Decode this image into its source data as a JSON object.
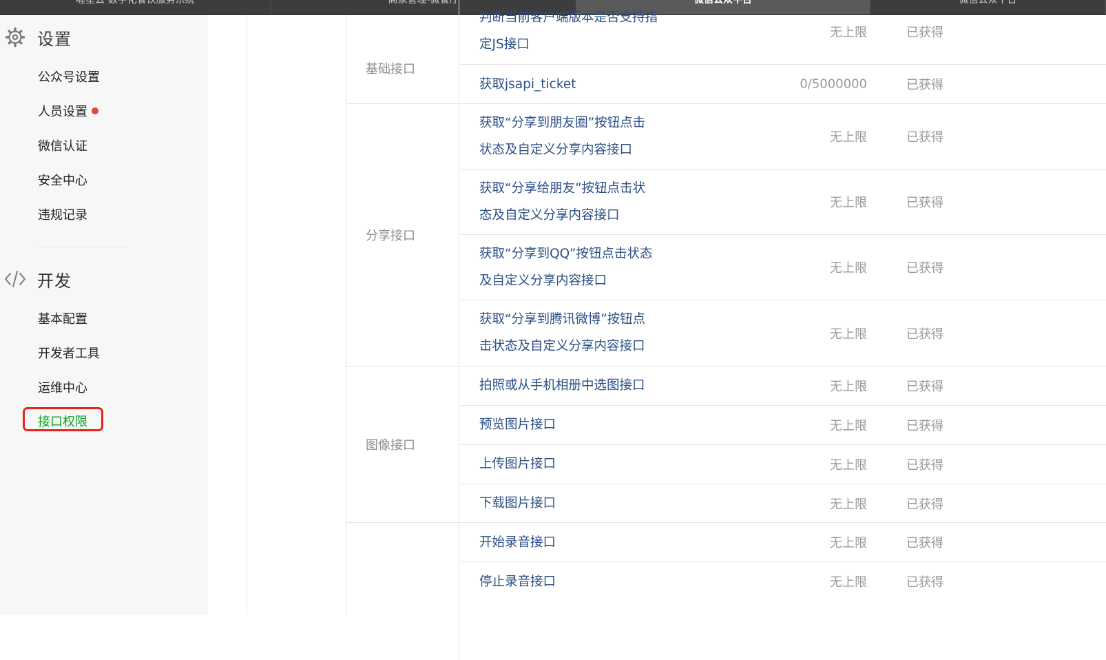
{
  "top_tabs": [
    {
      "label": "喔星云·数字化餐饮服务系统"
    },
    {
      "label": "商家管理-微餐厅"
    },
    {
      "label": "微信公众平台"
    },
    {
      "label": "微信公众平台"
    }
  ],
  "sidebar": {
    "settings": {
      "title": "设置",
      "icon": "gear-icon",
      "items": [
        {
          "label": "公众号设置"
        },
        {
          "label": "人员设置"
        },
        {
          "label": "微信认证"
        },
        {
          "label": "安全中心"
        },
        {
          "label": "违规记录"
        }
      ]
    },
    "develop": {
      "title": "开发",
      "icon": "code-icon",
      "items": [
        {
          "label": "基本配置"
        },
        {
          "label": "开发者工具"
        },
        {
          "label": "运维中心"
        },
        {
          "label": "接口权限"
        }
      ]
    }
  },
  "table": {
    "categories": [
      {
        "label": "基础接口"
      },
      {
        "label": "分享接口"
      },
      {
        "label": "图像接口"
      },
      {
        "label": ""
      }
    ],
    "rows": [
      {
        "name_line1": "判断当前客户端版本是否支持指",
        "name_line2": "定JS接口",
        "quota": "无上限",
        "status": "已获得"
      },
      {
        "name_line1": "获取jsapi_ticket",
        "quota": "0/5000000",
        "status": "已获得"
      },
      {
        "name_line1": "获取“分享到朋友圈”按钮点击",
        "name_line2": "状态及自定义分享内容接口",
        "quota": "无上限",
        "status": "已获得"
      },
      {
        "name_line1": "获取“分享给朋友”按钮点击状",
        "name_line2": "态及自定义分享内容接口",
        "quota": "无上限",
        "status": "已获得"
      },
      {
        "name_line1": "获取“分享到QQ”按钮点击状态",
        "name_line2": "及自定义分享内容接口",
        "quota": "无上限",
        "status": "已获得"
      },
      {
        "name_line1": "获取“分享到腾讯微博”按钮点",
        "name_line2": "击状态及自定义分享内容接口",
        "quota": "无上限",
        "status": "已获得"
      },
      {
        "name_line1": "拍照或从手机相册中选图接口",
        "quota": "无上限",
        "status": "已获得"
      },
      {
        "name_line1": "预览图片接口",
        "quota": "无上限",
        "status": "已获得"
      },
      {
        "name_line1": "上传图片接口",
        "quota": "无上限",
        "status": "已获得"
      },
      {
        "name_line1": "下载图片接口",
        "quota": "无上限",
        "status": "已获得"
      },
      {
        "name_line1": "开始录音接口",
        "quota": "无上限",
        "status": "已获得"
      },
      {
        "name_line1": "停止录音接口",
        "quota": "无上限",
        "status": "已获得"
      }
    ]
  },
  "colors": {
    "accent_green": "#07a320",
    "highlight_red": "#e8231b",
    "link_blue": "#2b4f86",
    "sidebar_bg": "#f7f7f7",
    "notification_dot": "#e64340"
  }
}
